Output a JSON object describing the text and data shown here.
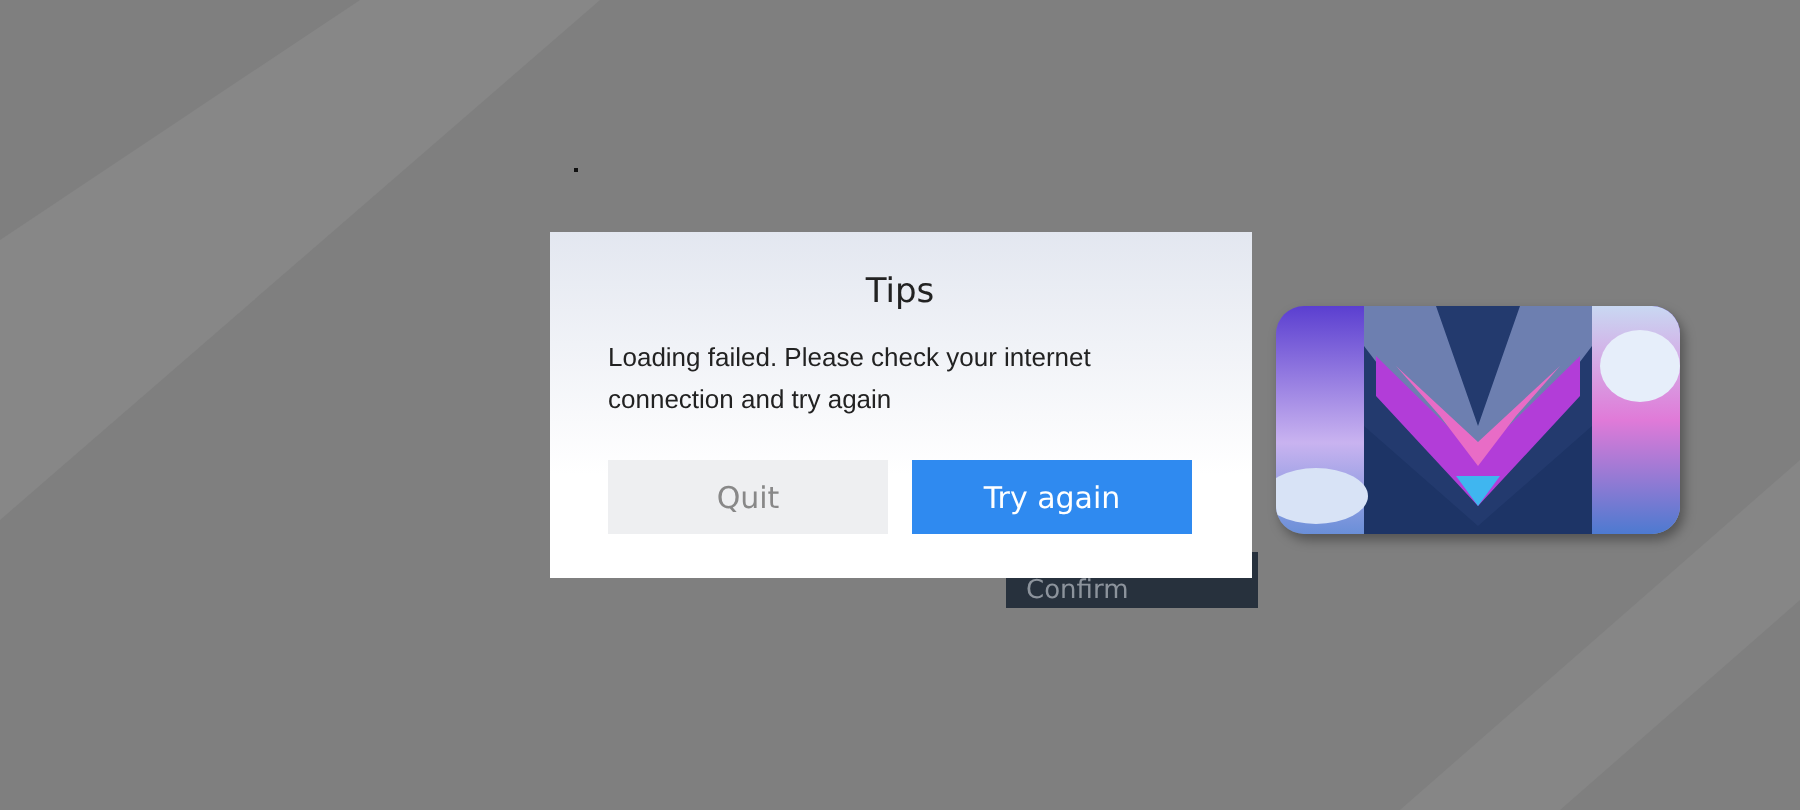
{
  "background_button": {
    "label": "Confirm"
  },
  "dialog": {
    "title": "Tips",
    "message": "Loading failed. Please check your internet connection and try again",
    "buttons": [
      {
        "label": "Quit",
        "kind": "secondary"
      },
      {
        "label": "Try again",
        "kind": "primary"
      }
    ]
  }
}
